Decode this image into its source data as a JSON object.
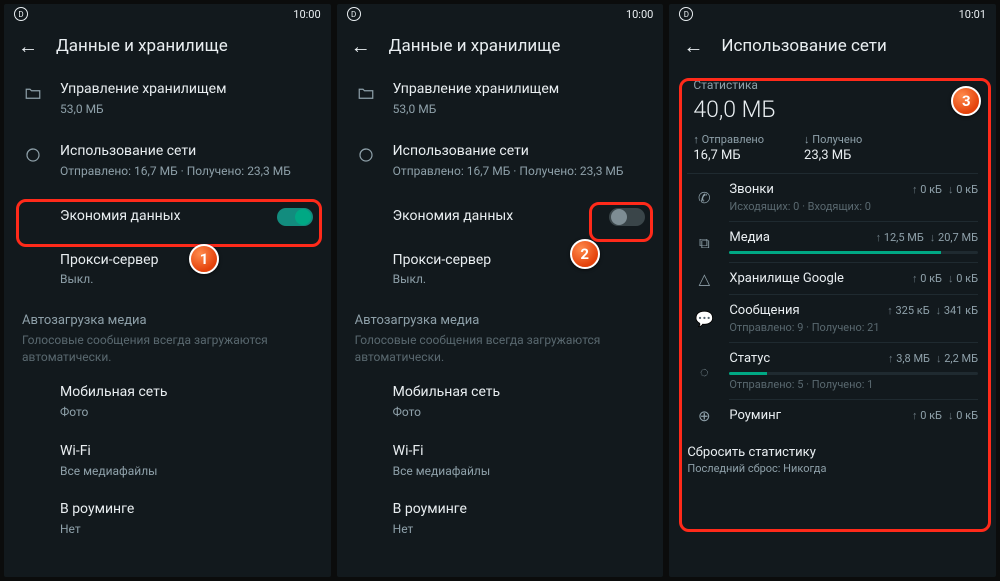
{
  "s1": {
    "time": "10:00",
    "header": "Данные и хранилище",
    "storage": {
      "title": "Управление хранилищем",
      "sub": "53,0 МБ"
    },
    "network": {
      "title": "Использование сети",
      "sub": "Отправлено: 16,7 МБ · Получено: 23,3 МБ"
    },
    "saver": {
      "title": "Экономия данных"
    },
    "proxy": {
      "title": "Прокси-сервер",
      "sub": "Выкл."
    },
    "auto": {
      "hdr": "Автозагрузка медиа",
      "sub": "Голосовые сообщения всегда загружаются автоматически."
    },
    "mobile": {
      "title": "Мобильная сеть",
      "sub": "Фото"
    },
    "wifi": {
      "title": "Wi-Fi",
      "sub": "Все медиафайлы"
    },
    "roam": {
      "title": "В роуминге",
      "sub": "Нет"
    }
  },
  "s2": {
    "time": "10:00",
    "header": "Данные и хранилище"
  },
  "s3": {
    "time": "10:01",
    "header": "Использование сети",
    "stats": "Статистика",
    "total": "40,0 МБ",
    "sent": {
      "lbl": "↑ Отправлено",
      "val": "16,7 МБ"
    },
    "recv": {
      "lbl": "↓ Получено",
      "val": "23,3 МБ"
    },
    "calls": {
      "title": "Звонки",
      "up": "0 кБ",
      "down": "0 кБ",
      "sub": "Исходящих: 0 · Входящих: 0"
    },
    "media": {
      "title": "Медиа",
      "up": "12,5 МБ",
      "down": "20,7 МБ"
    },
    "gdrive": {
      "title": "Хранилище Google",
      "up": "0 кБ",
      "down": "0 кБ"
    },
    "msgs": {
      "title": "Сообщения",
      "up": "325 кБ",
      "down": "341 кБ",
      "sub": "Отправлено: 9 · Получено: 21"
    },
    "status": {
      "title": "Статус",
      "up": "3,8 МБ",
      "down": "2,2 МБ",
      "sub": "Отправлено: 5 · Получено: 1"
    },
    "roaming": {
      "title": "Роуминг",
      "up": "0 кБ",
      "down": "0 кБ"
    },
    "reset": {
      "t": "Сбросить статистику",
      "s": "Последний сброс: Никогда"
    }
  }
}
